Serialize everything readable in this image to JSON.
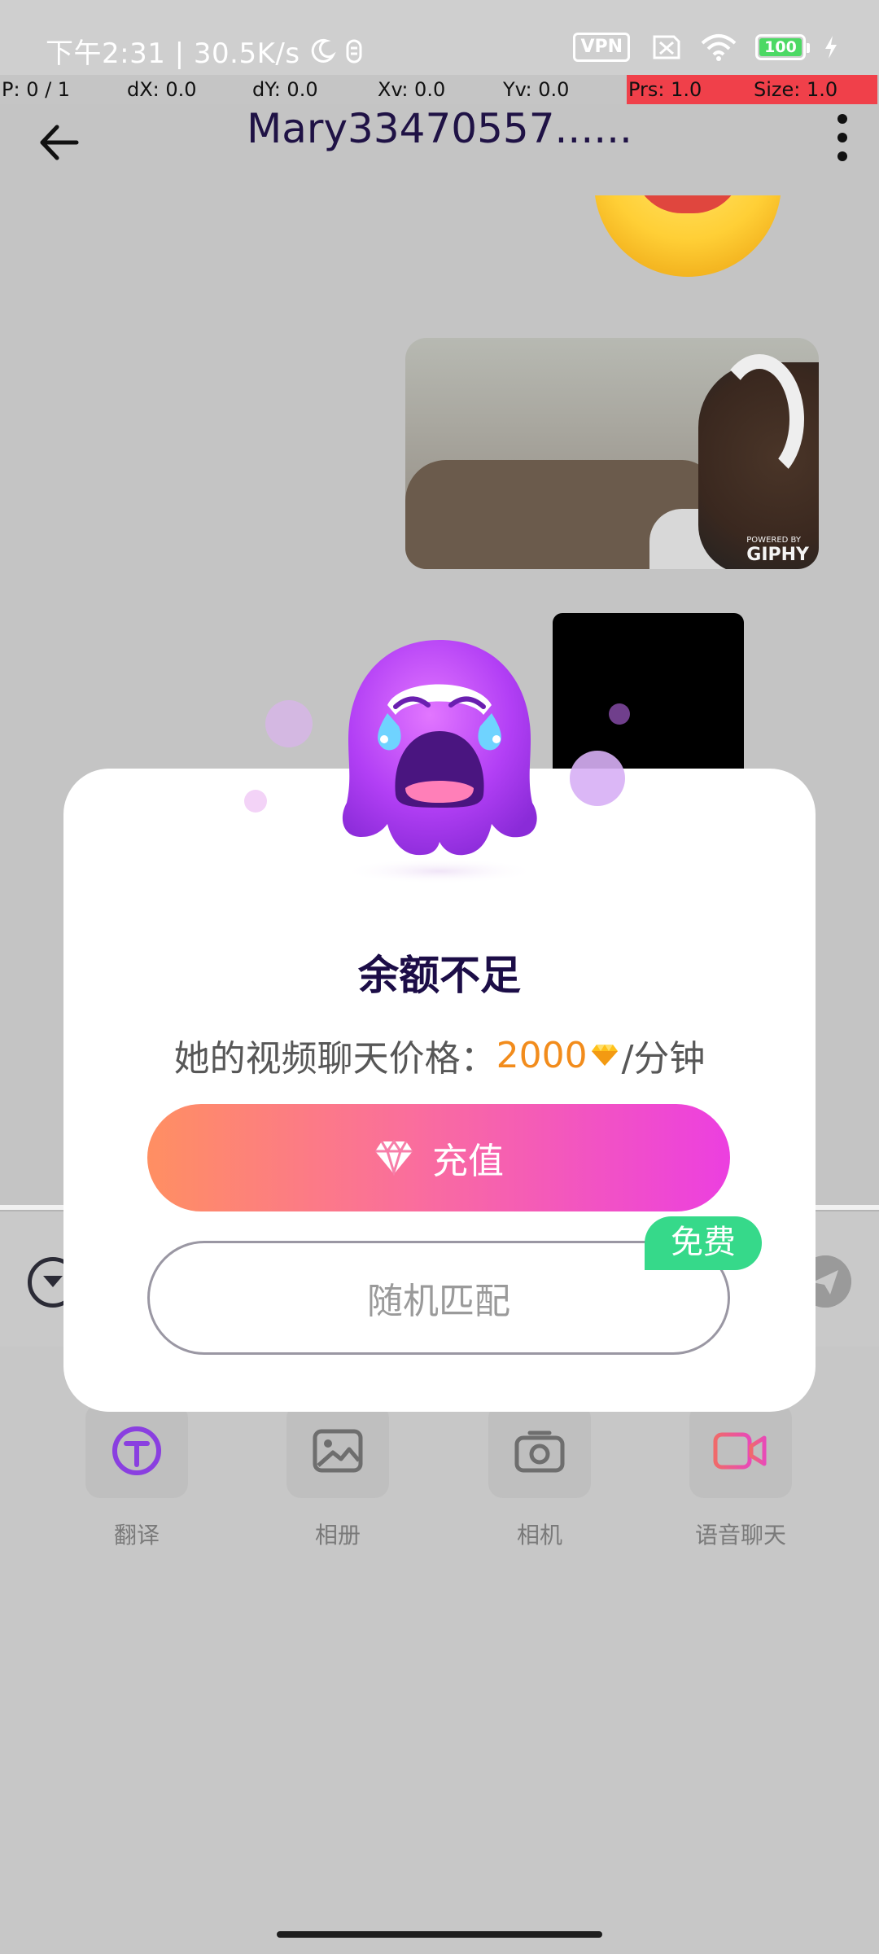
{
  "status_bar": {
    "time_speed": "下午2:31 | 30.5K/s",
    "vpn_label": "VPN",
    "battery_level": "100"
  },
  "debug": {
    "p": "P: 0 / 1",
    "dx": "dX: 0.0",
    "dy": "dY: 0.0",
    "xv": "Xv: 0.0",
    "yv": "Yv: 0.0",
    "prs": "Prs: 1.0",
    "size": "Size: 1.0"
  },
  "header": {
    "title": "Mary33470557......"
  },
  "chat": {
    "gif_badge_powered": "POWERED BY",
    "gif_badge_brand": "GIPHY"
  },
  "toolbar": {
    "items": [
      {
        "label": "翻译",
        "icon": "translate-icon",
        "color": "#8a3fe0"
      },
      {
        "label": "相册",
        "icon": "gallery-icon",
        "color": "#6e6e6e"
      },
      {
        "label": "相机",
        "icon": "camera-icon",
        "color": "#6e6e6e"
      },
      {
        "label": "语音聊天",
        "icon": "video-chat-icon",
        "color": "#f04a7a"
      }
    ]
  },
  "modal": {
    "title": "余额不足",
    "price_prefix": "她的视频聊天价格：",
    "price_value": "2000",
    "price_suffix": "/分钟",
    "recharge_label": "充值",
    "random_match_label": "随机匹配",
    "free_badge": "免费"
  },
  "colors": {
    "accent_gradient_start": "#ff8f62",
    "accent_gradient_end": "#ec3fe0",
    "price_orange": "#f28c1c",
    "free_green": "#36d98a",
    "mascot_purple": "#b23ff5"
  }
}
